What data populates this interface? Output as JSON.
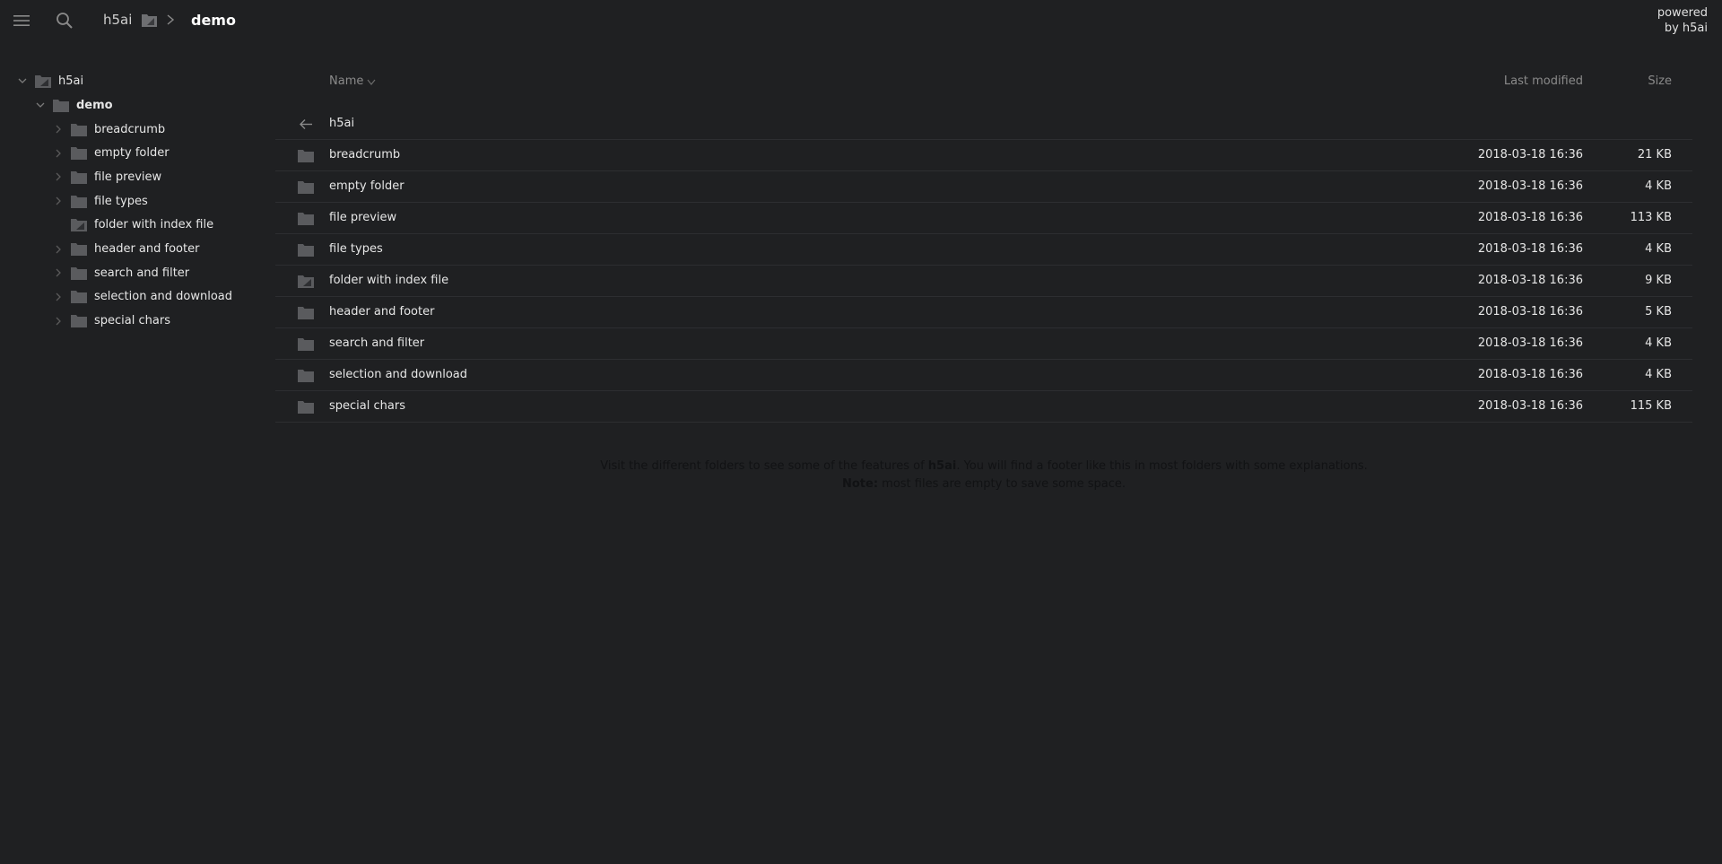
{
  "topbar": {
    "menu_icon": "menu-icon",
    "search_icon": "search-icon",
    "breadcrumb_root": "h5ai",
    "breadcrumb_current": "demo",
    "powered_line1": "powered",
    "powered_line2": "by h5ai"
  },
  "tree": {
    "root": "h5ai",
    "demo": "demo",
    "items": [
      {
        "label": "breadcrumb",
        "has_index": false
      },
      {
        "label": "empty folder",
        "has_index": false
      },
      {
        "label": "file preview",
        "has_index": false
      },
      {
        "label": "file types",
        "has_index": false
      },
      {
        "label": "folder with index file",
        "has_index": true
      },
      {
        "label": "header and footer",
        "has_index": false
      },
      {
        "label": "search and filter",
        "has_index": false
      },
      {
        "label": "selection and download",
        "has_index": false
      },
      {
        "label": "special chars",
        "has_index": false
      }
    ]
  },
  "list": {
    "headers": {
      "name": "Name",
      "modified": "Last modified",
      "size": "Size"
    },
    "parent": "h5ai",
    "rows": [
      {
        "name": "breadcrumb",
        "modified": "2018-03-18 16:36",
        "size": "21 KB",
        "has_index": false
      },
      {
        "name": "empty folder",
        "modified": "2018-03-18 16:36",
        "size": "4 KB",
        "has_index": false
      },
      {
        "name": "file preview",
        "modified": "2018-03-18 16:36",
        "size": "113 KB",
        "has_index": false
      },
      {
        "name": "file types",
        "modified": "2018-03-18 16:36",
        "size": "4 KB",
        "has_index": false
      },
      {
        "name": "folder with index file",
        "modified": "2018-03-18 16:36",
        "size": "9 KB",
        "has_index": true
      },
      {
        "name": "header and footer",
        "modified": "2018-03-18 16:36",
        "size": "5 KB",
        "has_index": false
      },
      {
        "name": "search and filter",
        "modified": "2018-03-18 16:36",
        "size": "4 KB",
        "has_index": false
      },
      {
        "name": "selection and download",
        "modified": "2018-03-18 16:36",
        "size": "4 KB",
        "has_index": false
      },
      {
        "name": "special chars",
        "modified": "2018-03-18 16:36",
        "size": "115 KB",
        "has_index": false
      }
    ]
  },
  "footer": {
    "line1_before": "Visit the different folders to see some of the features of ",
    "line1_bold": "h5ai",
    "line1_after": ". You will find a footer like this in most folders with some explanations.",
    "line2_bold": "Note:",
    "line2_after": " most files are empty to save some space."
  },
  "colors": {
    "background": "#1f2022",
    "folder": "#5a5b5e",
    "muted": "#8a8a8a"
  }
}
